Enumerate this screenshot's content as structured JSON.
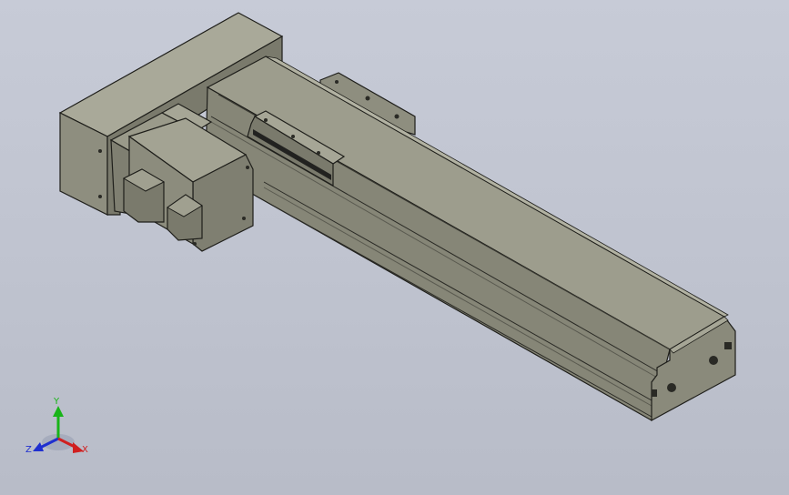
{
  "viewport": {
    "background_top": "#c7cbd7",
    "background_bottom": "#b8bcc8",
    "model_face_light": "#9c9c8c",
    "model_face_mid": "#8a8a7b",
    "model_face_dark": "#6f6f62",
    "model_edge": "#1e1e1a"
  },
  "triad": {
    "y_label": "Y",
    "z_label": "Z",
    "x_label": "X",
    "y_color": "#18b418",
    "z_color": "#1f2fd0",
    "x_color": "#d02020"
  }
}
